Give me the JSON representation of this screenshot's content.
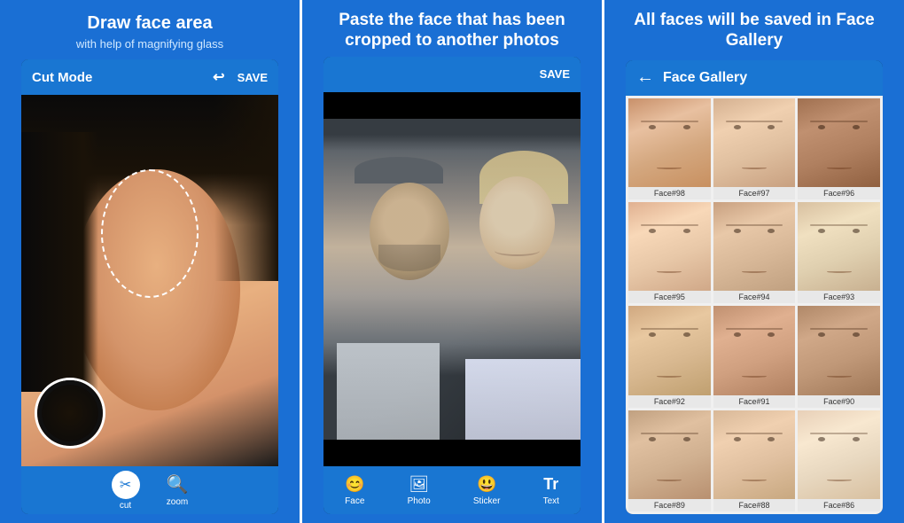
{
  "panel1": {
    "title": "Draw face area",
    "subtitle": "with help of magnifying glass",
    "appbar": {
      "mode_label": "Cut Mode",
      "save_label": "SAVE"
    },
    "tools": [
      {
        "id": "cut",
        "icon": "✂",
        "label": "cut"
      },
      {
        "id": "zoom",
        "icon": "🔍",
        "label": "zoom"
      }
    ]
  },
  "panel2": {
    "title": "Paste the face that has been cropped to another photos",
    "appbar": {
      "save_label": "SAVE"
    },
    "tools": [
      {
        "id": "face",
        "icon": "😊",
        "label": "Face"
      },
      {
        "id": "photo",
        "icon": "🖼",
        "label": "Photo"
      },
      {
        "id": "sticker",
        "icon": "😃",
        "label": "Sticker"
      },
      {
        "id": "text",
        "icon": "T",
        "label": "Text"
      }
    ]
  },
  "panel3": {
    "title": "All faces will be saved in Face Gallery",
    "gallery_title": "Face Gallery",
    "back_icon": "←",
    "faces": [
      {
        "id": "f98",
        "label": "Face#98",
        "class": "ft-1"
      },
      {
        "id": "f97",
        "label": "Face#97",
        "class": "ft-2"
      },
      {
        "id": "f96",
        "label": "Face#96",
        "class": "ft-3"
      },
      {
        "id": "f95",
        "label": "Face#95",
        "class": "ft-4"
      },
      {
        "id": "f94",
        "label": "Face#94",
        "class": "ft-5"
      },
      {
        "id": "f93",
        "label": "Face#93",
        "class": "ft-6"
      },
      {
        "id": "f92",
        "label": "Face#92",
        "class": "ft-7"
      },
      {
        "id": "f91",
        "label": "Face#91",
        "class": "ft-8"
      },
      {
        "id": "f90",
        "label": "Face#90",
        "class": "ft-9"
      },
      {
        "id": "f89",
        "label": "Face#89",
        "class": "ft-10"
      },
      {
        "id": "f88",
        "label": "Face#88",
        "class": "ft-11"
      },
      {
        "id": "f86",
        "label": "Face#86",
        "class": "ft-12"
      }
    ]
  }
}
